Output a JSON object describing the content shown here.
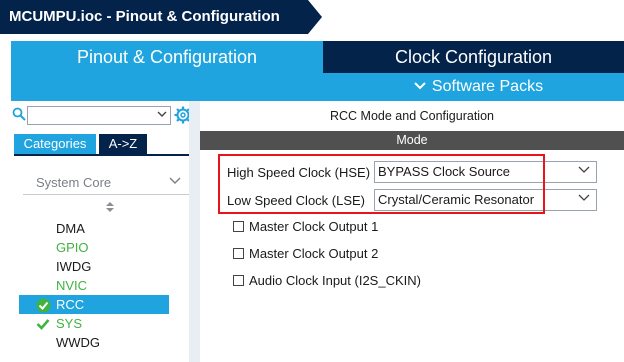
{
  "breadcrumb": {
    "title": "MCUMPU.ioc - Pinout & Configuration"
  },
  "tabs": {
    "pinout": "Pinout & Configuration",
    "clock": "Clock Configuration",
    "software_packs": "Software Packs"
  },
  "left_panel": {
    "search": {
      "value": "",
      "placeholder": ""
    },
    "categories_tab": "Categories",
    "az_tab": "A->Z",
    "section": "System Core",
    "items": [
      {
        "label": "DMA",
        "status": "none"
      },
      {
        "label": "GPIO",
        "status": "enabled"
      },
      {
        "label": "IWDG",
        "status": "none"
      },
      {
        "label": "NVIC",
        "status": "enabled"
      },
      {
        "label": "RCC",
        "status": "configured",
        "selected": true
      },
      {
        "label": "SYS",
        "status": "configured"
      },
      {
        "label": "WWDG",
        "status": "none"
      }
    ]
  },
  "main": {
    "title": "RCC Mode and Configuration",
    "mode_header": "Mode",
    "hse": {
      "label": "High Speed Clock (HSE)",
      "value": "BYPASS Clock Source"
    },
    "lse": {
      "label": "Low Speed Clock (LSE)",
      "value": "Crystal/Ceramic Resonator"
    },
    "checkboxes": [
      {
        "label": "Master Clock Output 1",
        "checked": false
      },
      {
        "label": "Master Clock Output 2",
        "checked": false
      },
      {
        "label": "Audio Clock Input (I2S_CKIN)",
        "checked": false
      }
    ]
  },
  "colors": {
    "brand_dark": "#03234b",
    "accent_blue": "#1fa4df",
    "mode_bar": "#505050",
    "enabled_green": "#3fb33f",
    "highlight_red": "#e8141a"
  }
}
